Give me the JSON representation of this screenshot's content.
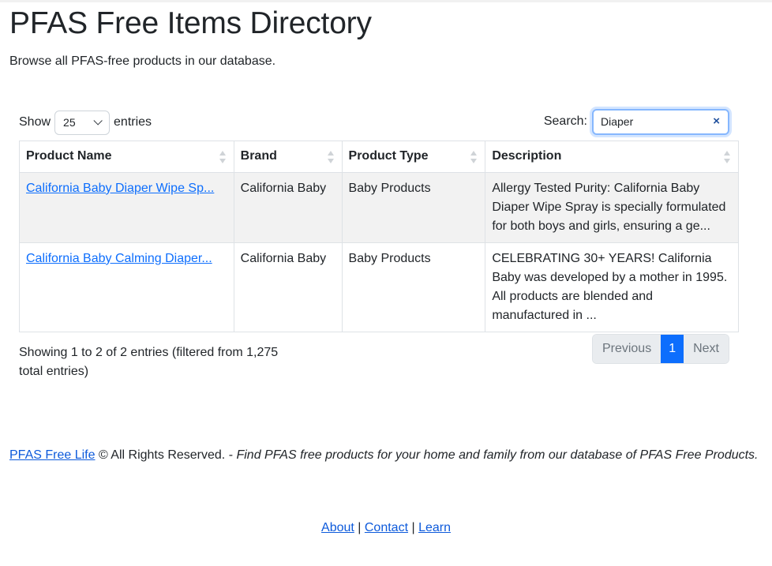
{
  "page": {
    "title": "PFAS Free Items Directory",
    "subtitle": "Browse all PFAS-free products in our database."
  },
  "controls": {
    "show_label": "Show",
    "entries_value": "25",
    "entries_label": "entries",
    "search_label": "Search:",
    "search_value": "Diaper",
    "clear_icon": "×"
  },
  "table": {
    "headers": [
      "Product Name",
      "Brand",
      "Product Type",
      "Description"
    ],
    "rows": [
      {
        "name": "California Baby Diaper Wipe Sp...",
        "brand": "California Baby",
        "type": "Baby Products",
        "description": "Allergy Tested Purity: California Baby Diaper Wipe Spray is specially formulated for both boys and girls, ensuring a ge..."
      },
      {
        "name": "California Baby Calming Diaper...",
        "brand": "California Baby",
        "type": "Baby Products",
        "description": "CELEBRATING 30+ YEARS! California Baby was developed by a mother in 1995. All products are blended and manufactured in ..."
      }
    ]
  },
  "info": "Showing 1 to 2 of 2 entries (filtered from 1,275 total entries)",
  "pagination": {
    "previous": "Previous",
    "current": "1",
    "next": "Next"
  },
  "footer": {
    "site_link": "PFAS Free Life",
    "rights": " © All Rights Reserved. - ",
    "tagline": "Find PFAS free products for your home and family from our database of PFAS Free Products.",
    "about": "About",
    "contact": "Contact",
    "learn": "Learn",
    "sep": " | "
  },
  "colors": {
    "accent": "#0d6efd",
    "striped_row": "#f2f2f2",
    "border": "#dee2e6"
  }
}
